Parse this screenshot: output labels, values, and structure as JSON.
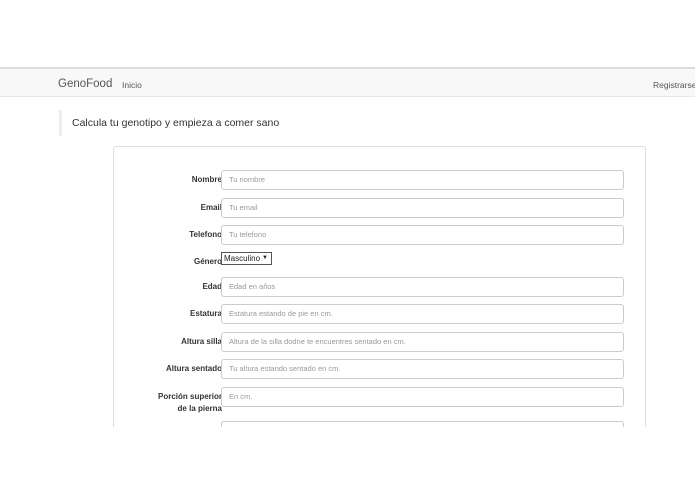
{
  "navbar": {
    "brand": "GenoFood",
    "home": "Inicio",
    "register": "Registrarse"
  },
  "lead": "Calcula tu genotipo y empieza a comer sano",
  "form": {
    "nombre": {
      "label": "Nombre",
      "placeholder": "Tu nombre"
    },
    "email": {
      "label": "Email",
      "placeholder": "Tu email"
    },
    "telefono": {
      "label": "Telefono",
      "placeholder": "Tu telefono"
    },
    "genero": {
      "label": "Género",
      "value": "Masculino"
    },
    "edad": {
      "label": "Edad",
      "placeholder": "Edad en años"
    },
    "estatura": {
      "label": "Estatura",
      "placeholder": "Estatura estando de pie en cm."
    },
    "altura_silla": {
      "label": "Altura silla",
      "placeholder": "Altura de la silla dodne te encuentres sentado en cm."
    },
    "altura_sentado": {
      "label": "Altura sentado",
      "placeholder": "Tu altura estando sentado en cm."
    },
    "porcion_pierna": {
      "label_line1": "Porción superior",
      "label_line2": "de la pierna",
      "placeholder": "En cm."
    }
  }
}
